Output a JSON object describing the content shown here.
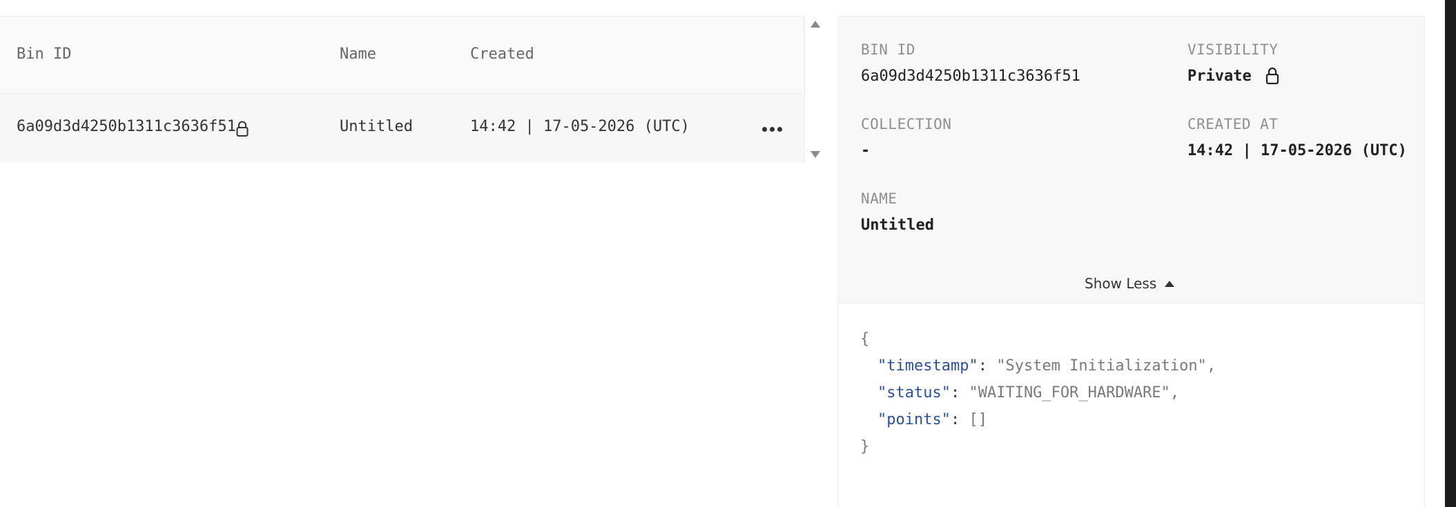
{
  "table": {
    "headers": {
      "bin_id": "Bin ID",
      "name": "Name",
      "created": "Created"
    },
    "rows": [
      {
        "bin_id": "6a09d3d4250b1311c3636f51",
        "name": "Untitled",
        "created": "14:42 | 17-05-2026 (UTC)",
        "locked": true
      }
    ]
  },
  "detail": {
    "bin_id_label": "BIN ID",
    "bin_id_value": "6a09d3d4250b1311c3636f51",
    "visibility_label": "VISIBILITY",
    "visibility_value": "Private",
    "collection_label": "COLLECTION",
    "collection_value": "-",
    "created_at_label": "CREATED AT",
    "created_at_value": "14:42 | 17-05-2026 (UTC)",
    "name_label": "NAME",
    "name_value": "Untitled",
    "toggle_label": "Show Less"
  },
  "json_content": {
    "open_brace": "{",
    "close_brace": "}",
    "lines": [
      {
        "key": "\"timestamp\"",
        "sep": ": ",
        "value": "\"System Initialization\"",
        "trail": ","
      },
      {
        "key": "\"status\"",
        "sep": ": ",
        "value": "\"WAITING_FOR_HARDWARE\"",
        "trail": ","
      },
      {
        "key": "\"points\"",
        "sep": ": ",
        "value": "[]",
        "trail": ""
      }
    ]
  },
  "icons": {
    "lock": "lock-icon",
    "more": "more-horizontal-icon",
    "caret": "caret-up-icon",
    "scroll_up": "scroll-up-arrow-icon",
    "scroll_down": "scroll-down-arrow-icon"
  },
  "colors": {
    "json_key": "#2b4f9a",
    "panel_bg": "#f8f8f8",
    "border": "#ececec"
  }
}
